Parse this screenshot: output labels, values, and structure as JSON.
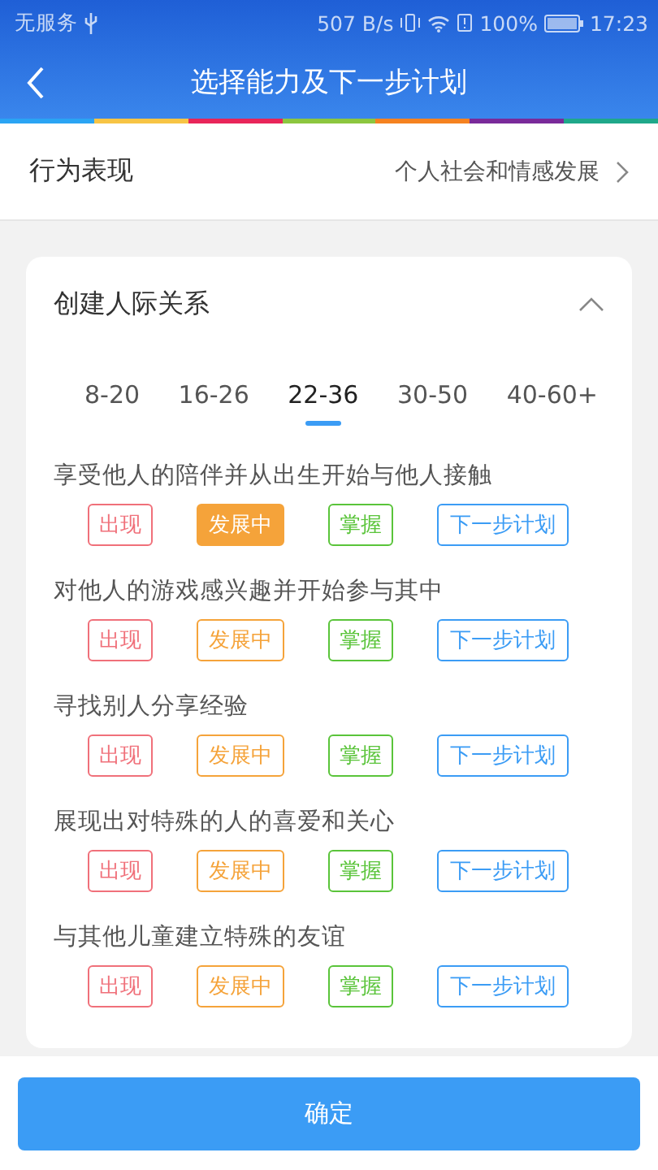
{
  "status_bar": {
    "carrier": "无服务",
    "speed": "507 B/s",
    "battery": "100%",
    "time": "17:23"
  },
  "header": {
    "title": "选择能力及下一步计划"
  },
  "category": {
    "label": "行为表现",
    "value": "个人社会和情感发展"
  },
  "section": {
    "title": "创建人际关系",
    "expanded": true,
    "tabs": [
      {
        "label": "8-20",
        "selected": false
      },
      {
        "label": "16-26",
        "selected": false
      },
      {
        "label": "22-36",
        "selected": true
      },
      {
        "label": "30-50",
        "selected": false
      },
      {
        "label": "40-60+",
        "selected": false
      }
    ],
    "items": [
      {
        "text": "享受他人的陪伴并从出生开始与他人接触",
        "options": [
          {
            "label": "出现",
            "color": "#f0707a",
            "selected": false
          },
          {
            "label": "发展中",
            "color": "#f5a33a",
            "selected": true
          },
          {
            "label": "掌握",
            "color": "#5ac43a",
            "selected": false
          },
          {
            "label": "下一步计划",
            "color": "#3b9cf5",
            "selected": false
          }
        ]
      },
      {
        "text": "对他人的游戏感兴趣并开始参与其中",
        "options": [
          {
            "label": "出现",
            "color": "#f0707a",
            "selected": false
          },
          {
            "label": "发展中",
            "color": "#f5a33a",
            "selected": false
          },
          {
            "label": "掌握",
            "color": "#5ac43a",
            "selected": false
          },
          {
            "label": "下一步计划",
            "color": "#3b9cf5",
            "selected": false
          }
        ]
      },
      {
        "text": "寻找别人分享经验",
        "options": [
          {
            "label": "出现",
            "color": "#f0707a",
            "selected": false
          },
          {
            "label": "发展中",
            "color": "#f5a33a",
            "selected": false
          },
          {
            "label": "掌握",
            "color": "#5ac43a",
            "selected": false
          },
          {
            "label": "下一步计划",
            "color": "#3b9cf5",
            "selected": false
          }
        ]
      },
      {
        "text": "展现出对特殊的人的喜爱和关心",
        "options": [
          {
            "label": "出现",
            "color": "#f0707a",
            "selected": false
          },
          {
            "label": "发展中",
            "color": "#f5a33a",
            "selected": false
          },
          {
            "label": "掌握",
            "color": "#5ac43a",
            "selected": false
          },
          {
            "label": "下一步计划",
            "color": "#3b9cf5",
            "selected": false
          }
        ]
      },
      {
        "text": "与其他儿童建立特殊的友谊",
        "options": [
          {
            "label": "出现",
            "color": "#f0707a",
            "selected": false
          },
          {
            "label": "发展中",
            "color": "#f5a33a",
            "selected": false
          },
          {
            "label": "掌握",
            "color": "#5ac43a",
            "selected": false
          },
          {
            "label": "下一步计划",
            "color": "#3b9cf5",
            "selected": false
          }
        ]
      }
    ]
  },
  "confirm_button": "确定"
}
